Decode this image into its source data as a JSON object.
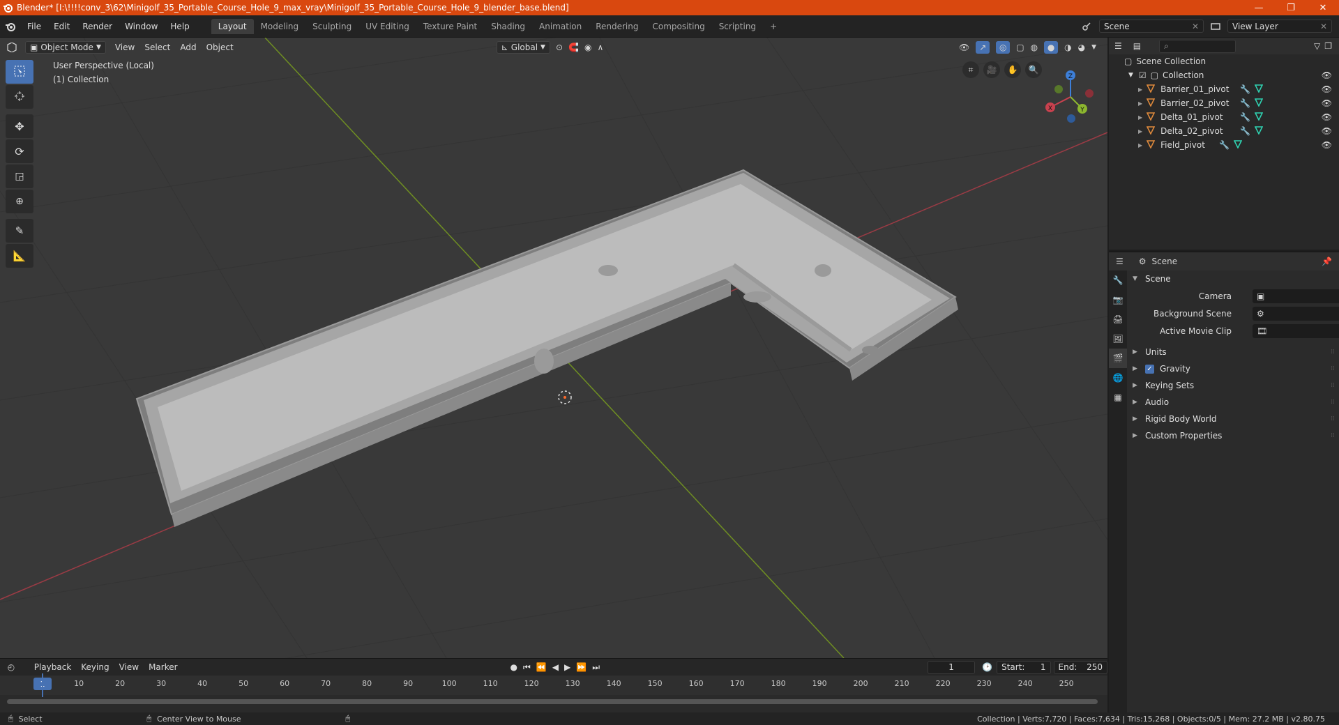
{
  "titlebar": {
    "title": "Blender* [I:\\!!!!conv_3\\62\\Minigolf_35_Portable_Course_Hole_9_max_vray\\Minigolf_35_Portable_Course_Hole_9_blender_base.blend]",
    "minimize": "—",
    "maximize": "❐",
    "close": "✕"
  },
  "menu": [
    "File",
    "Edit",
    "Render",
    "Window",
    "Help"
  ],
  "workspaces": [
    "Layout",
    "Modeling",
    "Sculpting",
    "UV Editing",
    "Texture Paint",
    "Shading",
    "Animation",
    "Rendering",
    "Compositing",
    "Scripting"
  ],
  "active_workspace": "Layout",
  "add_workspace": "+",
  "scene_selector": "Scene",
  "view_layer_selector": "View Layer",
  "viewport": {
    "mode": "Object Mode",
    "header_menus": [
      "View",
      "Select",
      "Add",
      "Object"
    ],
    "orientation": "Global",
    "info_line1": "User Perspective (Local)",
    "info_line2": "(1) Collection",
    "gizmo": {
      "x": "X",
      "y": "Y",
      "z": "Z"
    }
  },
  "timeline": {
    "menus": [
      "Playback",
      "Keying",
      "View",
      "Marker"
    ],
    "current_frame": "1",
    "start_label": "Start:",
    "start": "1",
    "end_label": "End:",
    "end": "250",
    "ruler_labels": [
      "10",
      "20",
      "30",
      "40",
      "50",
      "60",
      "70",
      "80",
      "90",
      "100",
      "110",
      "120",
      "130",
      "140",
      "150",
      "160",
      "170",
      "180",
      "190",
      "200",
      "210",
      "220",
      "230",
      "240",
      "250"
    ],
    "playhead": "1"
  },
  "statusbar": {
    "left_action": "Select",
    "mid_action": "Center View to Mouse",
    "stats": "Collection | Verts:7,720 | Faces:7,634 | Tris:15,268 | Objects:0/5 | Mem: 27.2 MB | v2.80.75"
  },
  "outliner": {
    "root": "Scene Collection",
    "collection": "Collection",
    "items": [
      "Barrier_01_pivot",
      "Barrier_02_pivot",
      "Delta_01_pivot",
      "Delta_02_pivot",
      "Field_pivot"
    ]
  },
  "properties": {
    "context": "Scene",
    "section": "Scene",
    "fields": [
      {
        "label": "Camera"
      },
      {
        "label": "Background Scene"
      },
      {
        "label": "Active Movie Clip"
      }
    ],
    "subsections": [
      "Units",
      "Gravity",
      "Keying Sets",
      "Audio",
      "Rigid Body World",
      "Custom Properties"
    ],
    "gravity_checked": true
  },
  "colors": {
    "titlebar": "#d9480f",
    "accent": "#4772b3",
    "x_axis": "#c8414e",
    "y_axis": "#8cb62f",
    "z_axis": "#3d7fd8",
    "object_icon": "#e08a3c",
    "modifier_icon": "#6aa0e8",
    "mesh_icon": "#2fd3b2"
  }
}
